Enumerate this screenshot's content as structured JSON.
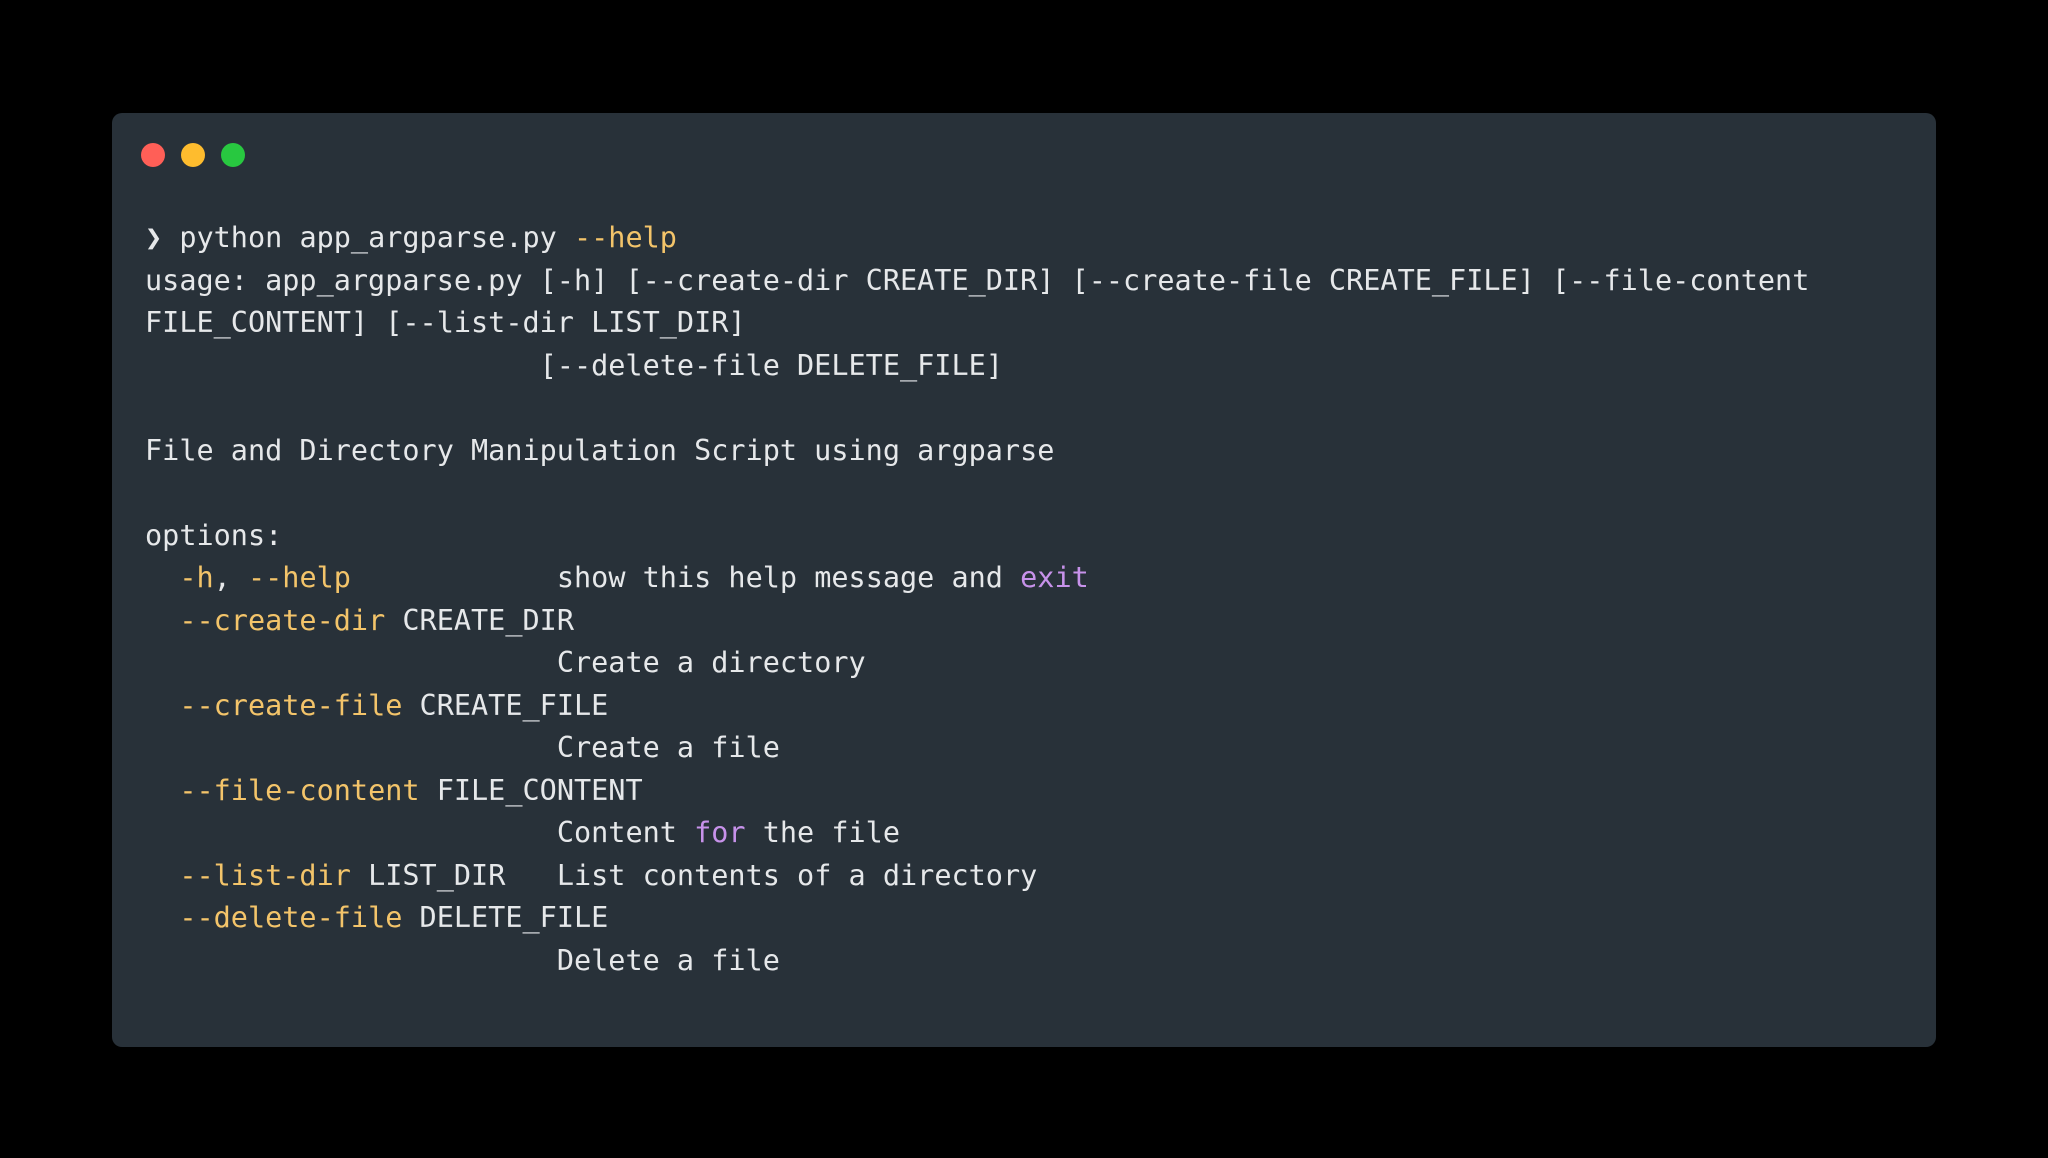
{
  "window": {
    "controls": [
      {
        "name": "close",
        "color": "#ff5f57"
      },
      {
        "name": "minimize",
        "color": "#febc2e"
      },
      {
        "name": "maximize",
        "color": "#28c840"
      }
    ]
  },
  "terminal": {
    "prompt_symbol": "❯",
    "command": " python app_argparse.py ",
    "command_flag": "--help",
    "usage_line_1": "usage: app_argparse.py [-h] [--create-dir CREATE_DIR] [--create-file CREATE_FILE] [--file-content",
    "usage_line_2": "FILE_CONTENT] [--list-dir LIST_DIR]",
    "usage_line_3": "                       [--delete-file DELETE_FILE]",
    "description": "File and Directory Manipulation Script using argparse",
    "options_header": "options:",
    "options": {
      "help": {
        "indent": "  ",
        "flag_short": "-h",
        "sep": ", ",
        "flag_long": "--help",
        "pad": "            ",
        "desc_a": "show this help message and ",
        "desc_keyword": "exit"
      },
      "create_dir": {
        "indent": "  ",
        "flag": "--create-dir",
        "metavar": " CREATE_DIR",
        "desc_indent": "                        ",
        "desc": "Create a directory"
      },
      "create_file": {
        "indent": "  ",
        "flag": "--create-file",
        "metavar": " CREATE_FILE",
        "desc_indent": "                        ",
        "desc": "Create a file"
      },
      "file_content": {
        "indent": "  ",
        "flag": "--file-content",
        "metavar": " FILE_CONTENT",
        "desc_indent": "                        ",
        "desc_a": "Content ",
        "desc_keyword": "for",
        "desc_b": " the file"
      },
      "list_dir": {
        "indent": "  ",
        "flag": "--list-dir",
        "metavar": " LIST_DIR   ",
        "desc": "List contents of a directory"
      },
      "delete_file": {
        "indent": "  ",
        "flag": "--delete-file",
        "metavar": " DELETE_FILE",
        "desc_indent": "                        ",
        "desc": "Delete a file"
      }
    }
  },
  "colors": {
    "background": "#000000",
    "window": "#283139",
    "text": "#e6e8ea",
    "flag": "#f3c46a",
    "keyword": "#c792ea"
  }
}
